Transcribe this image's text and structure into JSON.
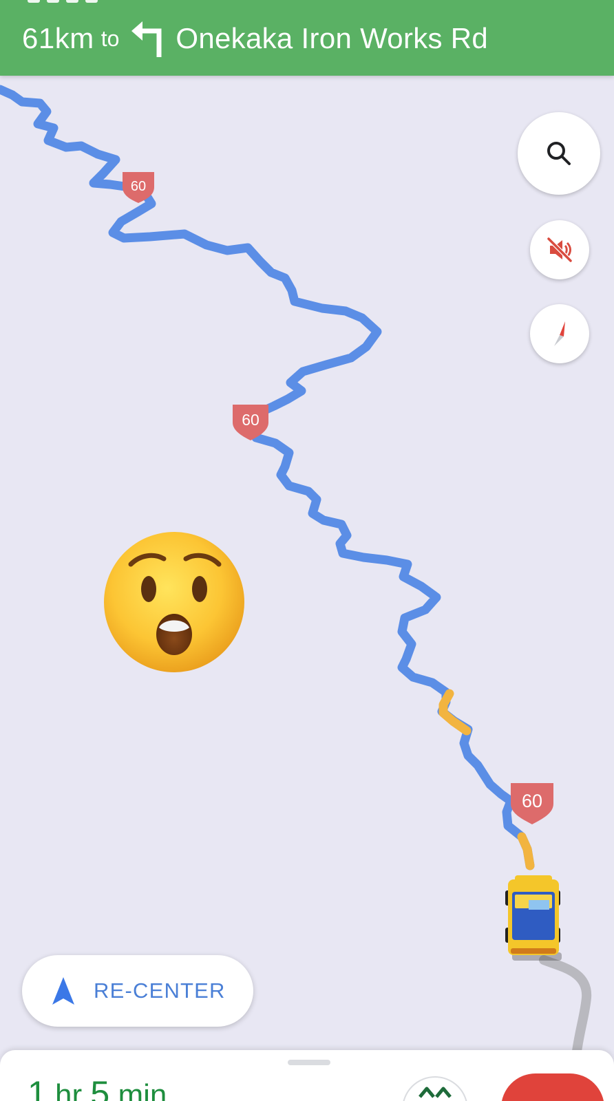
{
  "navigation": {
    "distance": "61km",
    "to_word": "to",
    "turn_direction": "turn-left-icon",
    "street": "Onekaka Iron Works Rd",
    "banner_color": "#5ab164"
  },
  "map": {
    "route_color": "#5b8ee6",
    "traffic_color": "#f2b440",
    "road_color": "#b9b9bf",
    "background_color": "#e8e7f3",
    "highway_shields": [
      "60",
      "60",
      "60"
    ],
    "overlay_emoji": "astonished-face-emoji",
    "vehicle": "yellow-car-icon"
  },
  "controls": {
    "search": "search-icon",
    "mute": "sound-off-icon",
    "compass": "compass-icon",
    "recenter_label": "RE-CENTER"
  },
  "trip": {
    "eta_hours": "1",
    "eta_hours_unit": "hr",
    "eta_minutes": "5",
    "eta_minutes_unit": "min"
  }
}
